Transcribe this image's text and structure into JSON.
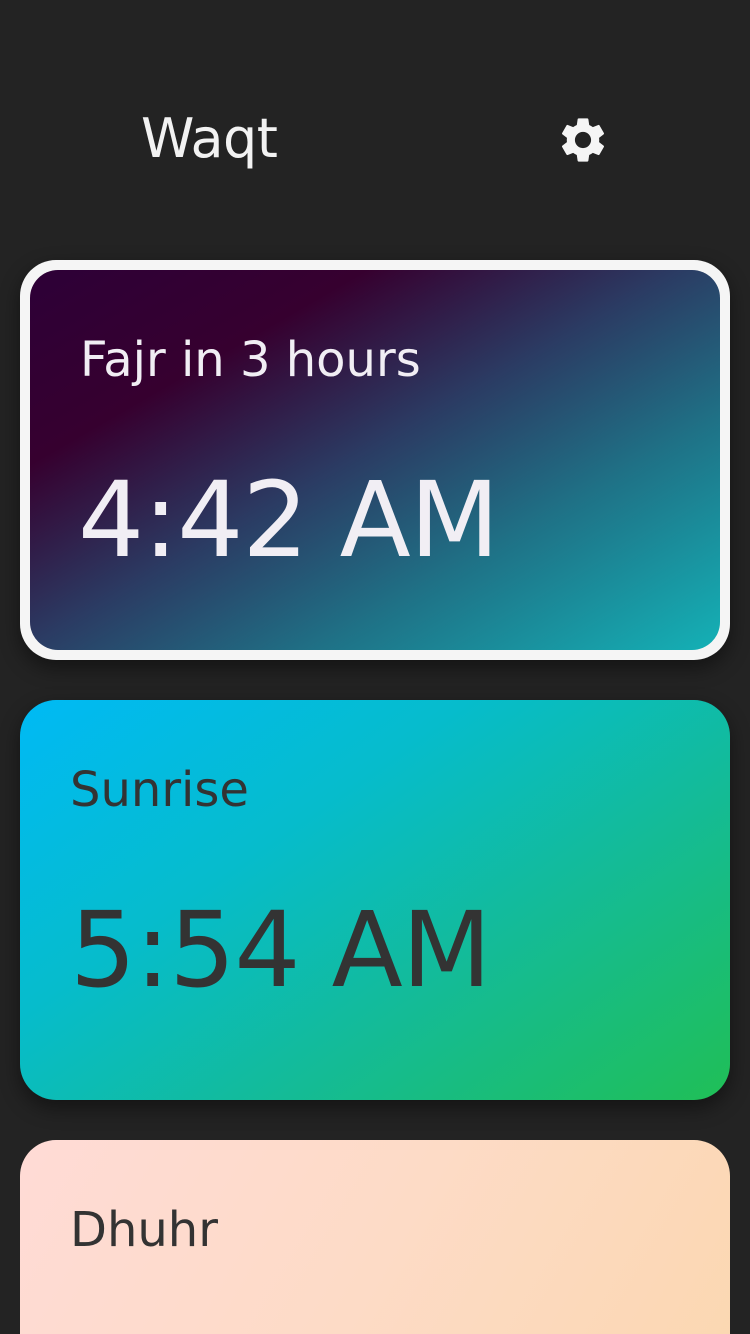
{
  "header": {
    "title": "Waqt",
    "settings_icon": "gear-icon"
  },
  "prayers": [
    {
      "label": "Fajr in 3 hours",
      "time": "4:42 AM",
      "highlighted": true,
      "gradient": [
        "#2d0037",
        "#14b1b6"
      ]
    },
    {
      "label": "Sunrise",
      "time": "5:54 AM",
      "highlighted": false,
      "gradient": [
        "#00baf5",
        "#20bf56"
      ]
    },
    {
      "label": "Dhuhr",
      "time": "",
      "highlighted": false,
      "gradient": [
        "#ffdbd6",
        "#fbd7b0"
      ]
    }
  ],
  "colors": {
    "background": "#232323",
    "highlight_border": "#f5f5f5",
    "light_text": "#f1eef4",
    "dark_text": "#333333"
  }
}
